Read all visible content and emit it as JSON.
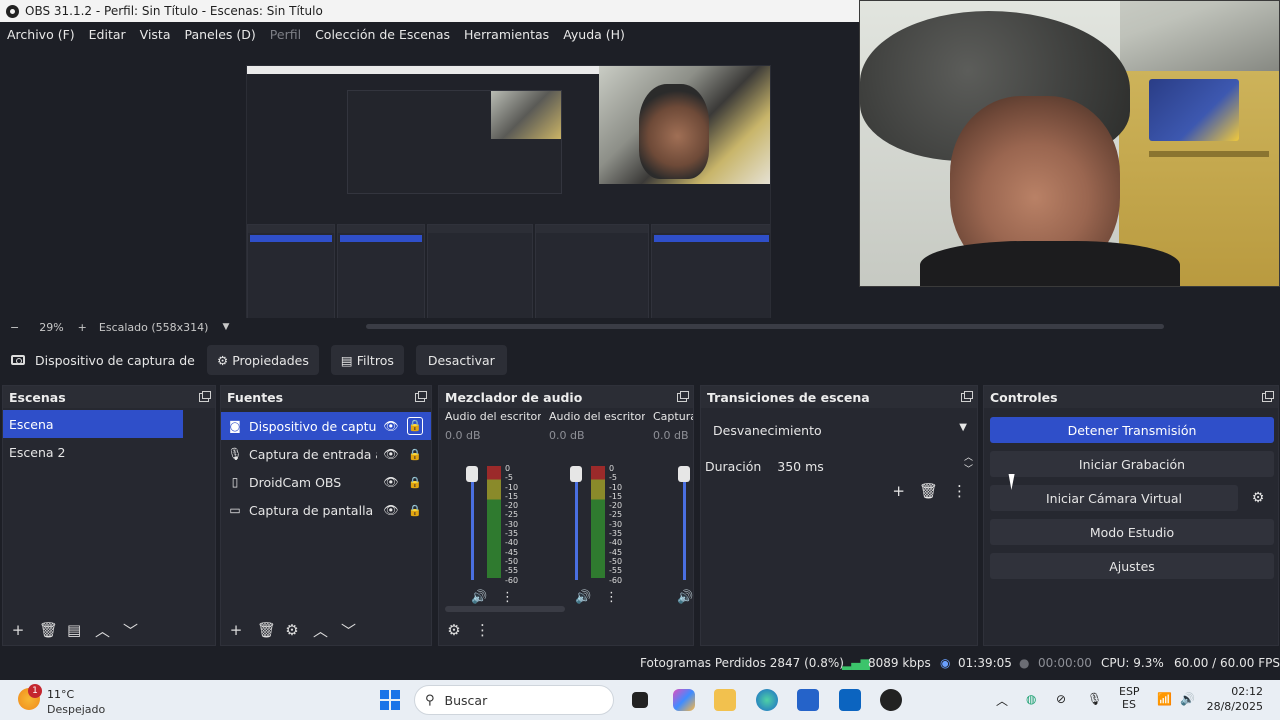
{
  "window": {
    "title": "OBS 31.1.2 - Perfil: Sin Título - Escenas: Sin Título"
  },
  "menu": [
    {
      "label": "Archivo (F)",
      "disabled": false
    },
    {
      "label": "Editar",
      "disabled": false
    },
    {
      "label": "Vista",
      "disabled": false
    },
    {
      "label": "Paneles (D)",
      "disabled": false
    },
    {
      "label": "Perfil",
      "disabled": true
    },
    {
      "label": "Colección de Escenas",
      "disabled": false
    },
    {
      "label": "Herramientas",
      "disabled": false
    },
    {
      "label": "Ayuda (H)",
      "disabled": false
    }
  ],
  "zoom": {
    "minus": "−",
    "value": "29%",
    "plus": "+",
    "scale_label": "Escalado (558x314)",
    "dropdown": "▼"
  },
  "source_toolbar": {
    "source_name": "Dispositivo de captura de v",
    "properties_label": "Propiedades",
    "filters_label": "Filtros",
    "deactivate_label": "Desactivar"
  },
  "scenes": {
    "title": "Escenas",
    "items": [
      {
        "label": "Escena",
        "selected": true
      },
      {
        "label": "Escena 2",
        "selected": false
      }
    ]
  },
  "sources": {
    "title": "Fuentes",
    "items": [
      {
        "label": "Dispositivo de captura",
        "icon": "camera-icon",
        "glyph": "◙",
        "selected": true
      },
      {
        "label": "Captura de entrada au",
        "icon": "microphone-icon",
        "glyph": "🎙",
        "selected": false
      },
      {
        "label": "DroidCam OBS",
        "icon": "file-icon",
        "glyph": "▯",
        "selected": false
      },
      {
        "label": "Captura de pantalla",
        "icon": "monitor-icon",
        "glyph": "▭",
        "selected": false
      }
    ]
  },
  "mixer": {
    "title": "Mezclador de audio",
    "channels": [
      {
        "name": "Audio del escritorio",
        "db": "0.0 dB"
      },
      {
        "name": "Audio del escritorio",
        "db": "0.0 dB"
      },
      {
        "name": "Captura",
        "db": "0.0 dB"
      }
    ],
    "scale": [
      "0",
      "-5",
      "-10",
      "-15",
      "-20",
      "-25",
      "-30",
      "-35",
      "-40",
      "-45",
      "-50",
      "-55",
      "-60"
    ]
  },
  "transitions": {
    "title": "Transiciones de escena",
    "selected": "Desvanecimiento",
    "duration_label": "Duración",
    "duration_value": "350 ms"
  },
  "controls": {
    "title": "Controles",
    "stop_stream": "Detener Transmisión",
    "start_record": "Iniciar Grabación",
    "virtual_cam": "Iniciar Cámara Virtual",
    "studio_mode": "Modo Estudio",
    "settings": "Ajustes"
  },
  "status": {
    "dropped_frames": "Fotogramas Perdidos 2847 (0.8%)",
    "bitrate": "8089 kbps",
    "stream_time": "01:39:05",
    "record_time": "00:00:00",
    "cpu": "CPU: 9.3%",
    "fps": "60.00 / 60.00 FPS"
  },
  "taskbar": {
    "weather_badge": "1",
    "temperature": "11°C",
    "condition": "Despejado",
    "search_placeholder": "Buscar",
    "lang_1": "ESP",
    "lang_2": "ES",
    "time": "02:12",
    "date": "28/8/2025"
  },
  "colors": {
    "accent": "#2f4fc9",
    "panel": "#262830",
    "background": "#1d1f26"
  }
}
